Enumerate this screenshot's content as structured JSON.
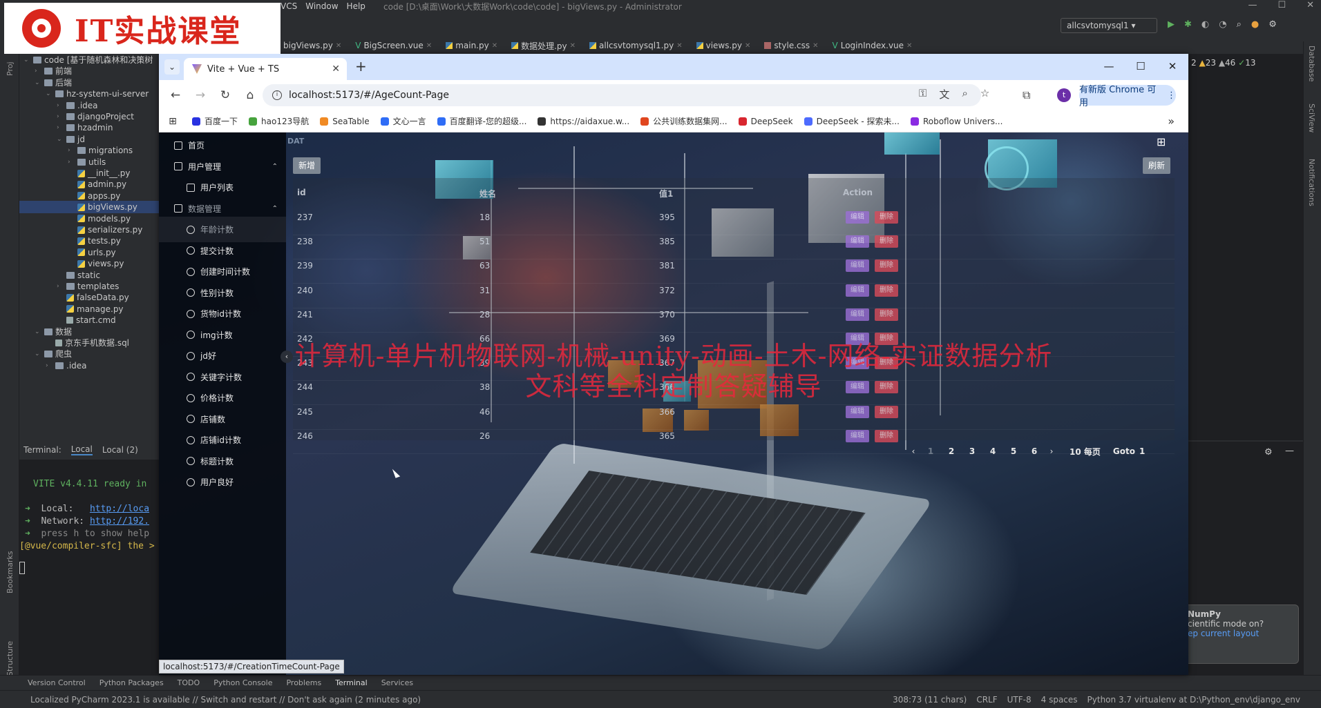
{
  "ide": {
    "menus": [
      "VCS",
      "Window",
      "Help"
    ],
    "title": "code [D:\\桌面\\Work\\大数据Work\\code\\code] - bigViews.py - Administrator",
    "logo_text": "IT实战课堂",
    "run_config": "allcsvtomysql1",
    "editor_tabs": [
      "bigViews.py",
      "BigScreen.vue",
      "main.py",
      "数据处理.py",
      "allcsvtomysql1.py",
      "views.py",
      "style.css",
      "LoginIndex.vue"
    ],
    "left_strip": [
      "Proj",
      "Bookmarks",
      "Structure"
    ],
    "right_strip": [
      "Database",
      "SciView",
      "Notifications"
    ],
    "inspection_counts": {
      "a": "2",
      "warn1": "23",
      "warn2": "46",
      "ok": "13"
    },
    "project_tree": [
      {
        "label": "code [基于随机森林和决策树",
        "depth": 0,
        "kind": "folder",
        "open": true
      },
      {
        "label": "前端",
        "depth": 1,
        "kind": "folder",
        "open": false
      },
      {
        "label": "后端",
        "depth": 1,
        "kind": "folder",
        "open": true
      },
      {
        "label": "hz-system-ui-server",
        "depth": 2,
        "kind": "folder",
        "open": true
      },
      {
        "label": ".idea",
        "depth": 3,
        "kind": "folder",
        "open": false
      },
      {
        "label": "djangoProject",
        "depth": 3,
        "kind": "folder",
        "open": false
      },
      {
        "label": "hzadmin",
        "depth": 3,
        "kind": "folder",
        "open": false
      },
      {
        "label": "jd",
        "depth": 3,
        "kind": "folder",
        "open": true
      },
      {
        "label": "migrations",
        "depth": 4,
        "kind": "folder",
        "open": false
      },
      {
        "label": "utils",
        "depth": 4,
        "kind": "folder",
        "open": false
      },
      {
        "label": "__init__.py",
        "depth": 4,
        "kind": "py"
      },
      {
        "label": "admin.py",
        "depth": 4,
        "kind": "py"
      },
      {
        "label": "apps.py",
        "depth": 4,
        "kind": "py"
      },
      {
        "label": "bigViews.py",
        "depth": 4,
        "kind": "py",
        "selected": true
      },
      {
        "label": "models.py",
        "depth": 4,
        "kind": "py"
      },
      {
        "label": "serializers.py",
        "depth": 4,
        "kind": "py"
      },
      {
        "label": "tests.py",
        "depth": 4,
        "kind": "py"
      },
      {
        "label": "urls.py",
        "depth": 4,
        "kind": "py"
      },
      {
        "label": "views.py",
        "depth": 4,
        "kind": "py"
      },
      {
        "label": "static",
        "depth": 3,
        "kind": "folder-plain"
      },
      {
        "label": "templates",
        "depth": 3,
        "kind": "folder",
        "open": false
      },
      {
        "label": "falseData.py",
        "depth": 3,
        "kind": "py"
      },
      {
        "label": "manage.py",
        "depth": 3,
        "kind": "py"
      },
      {
        "label": "start.cmd",
        "depth": 3,
        "kind": "file"
      },
      {
        "label": "数据",
        "depth": 1,
        "kind": "folder",
        "open": true
      },
      {
        "label": "京东手机数据.sql",
        "depth": 2,
        "kind": "file"
      },
      {
        "label": "爬虫",
        "depth": 1,
        "kind": "folder",
        "open": true
      },
      {
        "label": ".idea",
        "depth": 2,
        "kind": "folder",
        "open": false
      }
    ],
    "terminal": {
      "tabs": [
        "Terminal:",
        "Local",
        "Local (2)"
      ],
      "vite_line": "VITE v4.4.11  ready in",
      "local_label": "Local:",
      "local_url": "http://loca",
      "network_label": "Network:",
      "network_url": "http://192.",
      "help_line": "press h to show help",
      "warn_line": "[@vue/compiler-sfc] the >"
    },
    "numpy_popup": {
      "title": "NumPy",
      "body": "cientific mode on?",
      "link": "ep current layout"
    },
    "bottom_tools": [
      "Version Control",
      "Python Packages",
      "TODO",
      "Python Console",
      "Problems",
      "Terminal",
      "Services"
    ],
    "status_message": "Localized PyCharm 2023.1 is available // Switch and restart // Don't ask again (2 minutes ago)",
    "status_right": [
      "308:73 (11 chars)",
      "CRLF",
      "UTF-8",
      "4 spaces",
      "Python 3.7 virtualenv at D:\\Python_env\\django_env"
    ]
  },
  "browser": {
    "tab_title": "Vite + Vue + TS",
    "url": "localhost:5173/#/AgeCount-Page",
    "update_button": "有新版 Chrome 可用",
    "profile_letter": "t",
    "bookmarks": [
      {
        "label": "百度一下",
        "color": "#2932e1"
      },
      {
        "label": "hao123导航",
        "color": "#46a33d"
      },
      {
        "label": "SeaTable",
        "color": "#f08a24"
      },
      {
        "label": "文心一言",
        "color": "#2f6df6"
      },
      {
        "label": "百度翻译-您的超级...",
        "color": "#2f6df6"
      },
      {
        "label": "https://aidaxue.w...",
        "color": "#333333"
      },
      {
        "label": "公共训练数据集网...",
        "color": "#e0461f"
      },
      {
        "label": "DeepSeek",
        "color": "#d8262f"
      },
      {
        "label": "DeepSeek - 探索未...",
        "color": "#4d6bfe"
      },
      {
        "label": "Roboflow Univers...",
        "color": "#8a2be2"
      }
    ],
    "status_url": "localhost:5173/#/CreationTimeCount-Page"
  },
  "app": {
    "menu": [
      {
        "label": "首页",
        "icon": "home-icon",
        "level": 0
      },
      {
        "label": "用户管理",
        "icon": "users-icon",
        "level": 0,
        "caret": "up"
      },
      {
        "label": "用户列表",
        "icon": "user-list-icon",
        "level": 1
      },
      {
        "label": "数据管理",
        "icon": "data-icon",
        "level": 0,
        "caret": "up",
        "dim": true
      },
      {
        "label": "年龄计数",
        "icon": "pie-icon",
        "level": 1,
        "active": true
      },
      {
        "label": "提交计数",
        "icon": "pie-icon",
        "level": 1
      },
      {
        "label": "创建时间计数",
        "icon": "pie-icon",
        "level": 1
      },
      {
        "label": "性别计数",
        "icon": "pie-icon",
        "level": 1
      },
      {
        "label": "货物id计数",
        "icon": "pie-icon",
        "level": 1
      },
      {
        "label": "img计数",
        "icon": "pie-icon",
        "level": 1
      },
      {
        "label": "jd好",
        "icon": "pie-icon",
        "level": 1
      },
      {
        "label": "关键字计数",
        "icon": "pie-icon",
        "level": 1
      },
      {
        "label": "价格计数",
        "icon": "pie-icon",
        "level": 1
      },
      {
        "label": "店铺数",
        "icon": "pie-icon",
        "level": 1
      },
      {
        "label": "店铺id计数",
        "icon": "pie-icon",
        "level": 1
      },
      {
        "label": "标题计数",
        "icon": "pie-icon",
        "level": 1
      },
      {
        "label": "用户良好",
        "icon": "pie-icon",
        "level": 1
      }
    ],
    "crumb": "DAT",
    "add_button": "新增",
    "refresh_button": "刷新",
    "columns": [
      "id",
      "姓名",
      "值1",
      "Action"
    ],
    "rows": [
      {
        "id": "237",
        "name": "18",
        "value": "395"
      },
      {
        "id": "238",
        "name": "51",
        "value": "385"
      },
      {
        "id": "239",
        "name": "63",
        "value": "381"
      },
      {
        "id": "240",
        "name": "31",
        "value": "372"
      },
      {
        "id": "241",
        "name": "28",
        "value": "370"
      },
      {
        "id": "242",
        "name": "66",
        "value": "369"
      },
      {
        "id": "243",
        "name": "39",
        "value": "367"
      },
      {
        "id": "244",
        "name": "38",
        "value": "366"
      },
      {
        "id": "245",
        "name": "46",
        "value": "366"
      },
      {
        "id": "246",
        "name": "26",
        "value": "365"
      }
    ],
    "edit_label": "编辑",
    "delete_label": "删除",
    "pager": {
      "prev": "‹",
      "next": "›",
      "pages": [
        "1",
        "2",
        "3",
        "4",
        "5",
        "6"
      ],
      "current": "1",
      "page_size": "10 每页",
      "goto_label": "Goto",
      "goto_value": "1"
    }
  },
  "watermark": {
    "line1": "计算机-单片机物联网-机械-unity-动画-土木-网络-实证数据分析",
    "line2": "文科等全科定制答疑辅导"
  }
}
